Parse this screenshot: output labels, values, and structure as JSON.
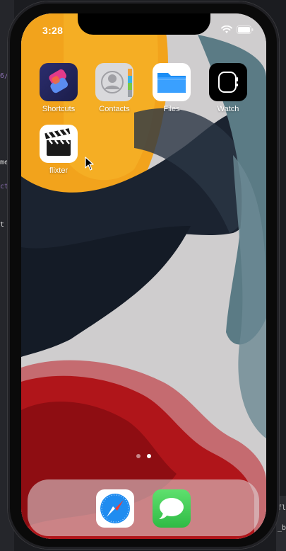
{
  "host": {
    "left_fragments": [
      "6/",
      "me",
      "ct",
      "t"
    ],
    "right_fragments": [
      "fl",
      "_b"
    ]
  },
  "status_bar": {
    "time": "3:28",
    "wifi_icon": "wifi-icon",
    "battery_icon": "battery-icon"
  },
  "home_screen": {
    "apps": [
      {
        "label": "Shortcuts",
        "icon": "shortcuts-icon"
      },
      {
        "label": "Contacts",
        "icon": "contacts-icon"
      },
      {
        "label": "Files",
        "icon": "files-icon"
      },
      {
        "label": "Watch",
        "icon": "watch-icon"
      },
      {
        "label": "flixter",
        "icon": "clapperboard-icon"
      }
    ],
    "page_count": 2,
    "current_page": 2
  },
  "dock": {
    "apps": [
      {
        "label": "Safari",
        "icon": "safari-icon"
      },
      {
        "label": "Messages",
        "icon": "messages-icon"
      }
    ]
  },
  "colors": {
    "wallpaper_orange": "#f2a31c",
    "wallpaper_navy": "#1b2330",
    "wallpaper_red": "#b0151a",
    "wallpaper_teal": "#5b7b85",
    "files_blue": "#1c8ef5",
    "messages_green": "#31c24e"
  }
}
